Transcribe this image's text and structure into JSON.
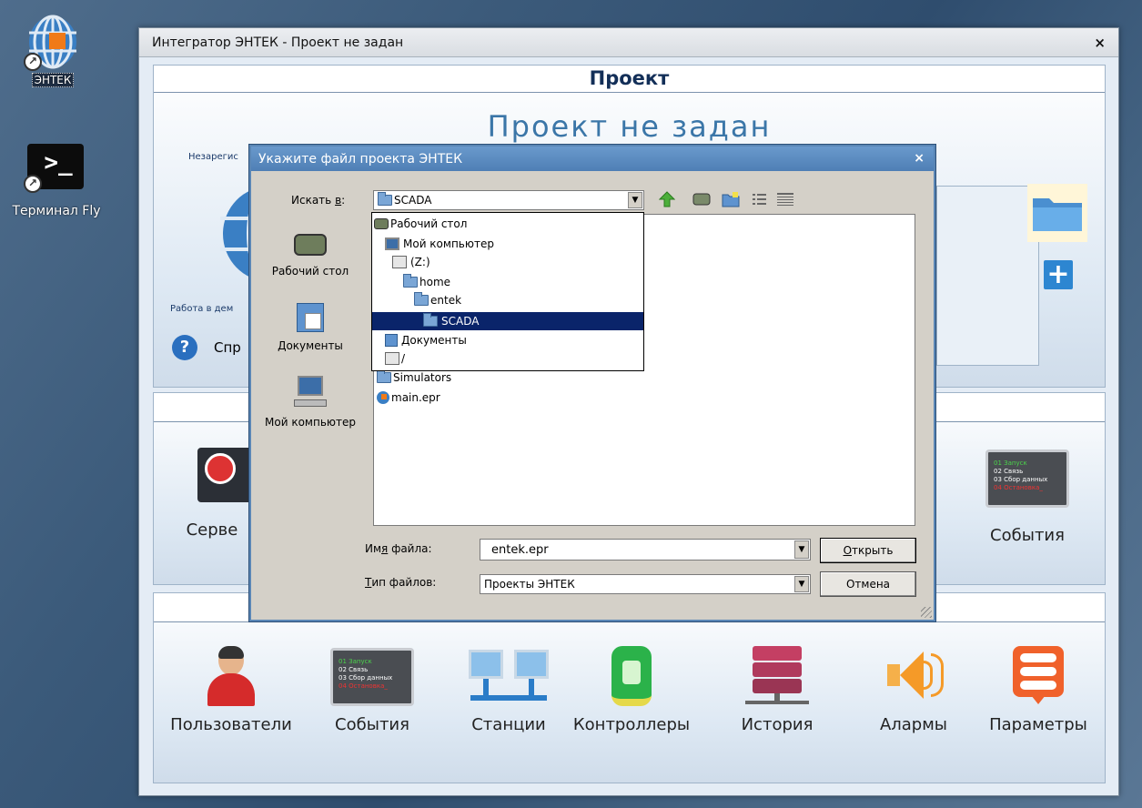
{
  "desktop": {
    "icons": [
      {
        "label": "ЭНТЕК",
        "icon": "entek-globe-icon"
      },
      {
        "label": "Терминал Fly",
        "icon": "terminal-icon"
      }
    ]
  },
  "window": {
    "title": "Интегратор ЭНТЕК - Проект не задан",
    "close": "×",
    "project_panel": {
      "header": "Проект",
      "status_title": "Проект не задан",
      "unregistered_text": "Незарегис",
      "demo_text": "Работа в дем",
      "help_label": "Спр"
    },
    "middle_panel": {
      "items": [
        {
          "label": "Серве",
          "icon": "server-icon"
        },
        {
          "label": "События",
          "icon": "events-icon"
        }
      ]
    },
    "bottom_panel": {
      "items": [
        {
          "label": "Пользователи",
          "icon": "user-icon"
        },
        {
          "label": "События",
          "icon": "events-icon"
        },
        {
          "label": "Станции",
          "icon": "stations-icon"
        },
        {
          "label": "Контроллеры",
          "icon": "controller-icon"
        },
        {
          "label": "История",
          "icon": "database-icon"
        },
        {
          "label": "Алармы",
          "icon": "speaker-icon"
        },
        {
          "label": "Параметры",
          "icon": "parameters-icon"
        }
      ]
    },
    "event_screen_lines": [
      "01 Запуск",
      "02 Связь",
      "03 Сбор данных",
      "04 Остановка_"
    ]
  },
  "dialog": {
    "title": "Укажите файл проекта ЭНТЕК",
    "close": "×",
    "look_in_label": "Искать ",
    "look_in_hotkey": "в",
    "look_in_suffix": ":",
    "look_in_value": "SCADA",
    "sidebar": [
      {
        "label": "Рабочий стол",
        "icon": "desktop-icon"
      },
      {
        "label": "Документы",
        "icon": "documents-icon"
      },
      {
        "label": "Мой компьютер",
        "icon": "computer-icon"
      }
    ],
    "dropdown_items": [
      {
        "label": "Рабочий стол",
        "icon": "desktop-icon",
        "indent": 0
      },
      {
        "label": "Мой компьютер",
        "icon": "computer-icon",
        "indent": 1
      },
      {
        "label": "(Z:)",
        "icon": "drive-icon",
        "indent": 2
      },
      {
        "label": "home",
        "icon": "folder-icon",
        "indent": 3
      },
      {
        "label": "entek",
        "icon": "folder-icon",
        "indent": 4
      },
      {
        "label": "SCADA",
        "icon": "folder-icon",
        "indent": 5,
        "selected": true
      },
      {
        "label": "Документы",
        "icon": "documents-icon",
        "indent": 1
      },
      {
        "label": "/",
        "icon": "drive-icon",
        "indent": 1
      }
    ],
    "files": [
      {
        "name": "Simulators",
        "icon": "folder-icon"
      },
      {
        "name": "main.epr",
        "icon": "entek-file-icon"
      }
    ],
    "filename_label": "Им",
    "filename_hotkey": "я",
    "filename_suffix": " файла:",
    "filename_value": "entek.epr",
    "filetype_hotkey": "Т",
    "filetype_label": "ип файлов:",
    "filetype_value": "Проекты ЭНТЕК",
    "open_hotkey": "О",
    "open_label": "ткрыть",
    "cancel_label": "Отмена"
  }
}
